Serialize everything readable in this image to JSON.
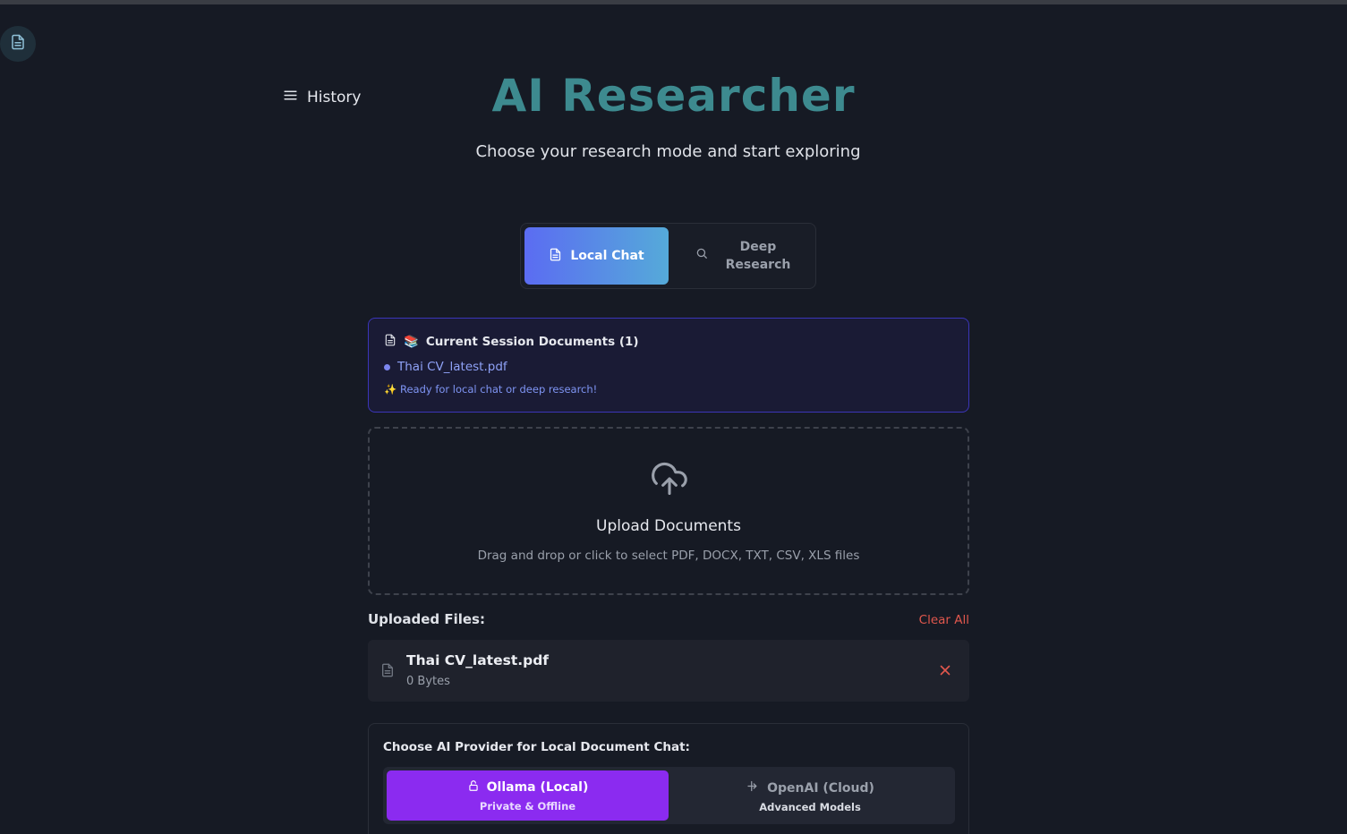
{
  "header": {
    "history_label": "History",
    "title": "AI Researcher",
    "subtitle": "Choose your research mode and start exploring"
  },
  "modes": {
    "active_label": "Local Chat",
    "inactive_label_line1": "Deep",
    "inactive_label_line2": "Research"
  },
  "session": {
    "heading_emoji": "📚",
    "heading": "Current Session Documents (1)",
    "file": "Thai CV_latest.pdf",
    "note": "✨ Ready for local chat or deep research!"
  },
  "upload": {
    "title": "Upload Documents",
    "subtitle": "Drag and drop or click to select PDF, DOCX, TXT, CSV, XLS files"
  },
  "uploaded": {
    "label": "Uploaded Files:",
    "clear_label": "Clear All",
    "files": [
      {
        "name": "Thai CV_latest.pdf",
        "size": "0 Bytes"
      }
    ]
  },
  "provider": {
    "label": "Choose AI Provider for Local Document Chat:",
    "options": [
      {
        "name": "Ollama (Local)",
        "sub": "Private & Offline",
        "icon": "lock-icon"
      },
      {
        "name": "OpenAI (Cloud)",
        "sub": "Advanced Models",
        "icon": "cloud-arrow-icon"
      }
    ]
  },
  "colors": {
    "title": "#3d8a8f",
    "mode_gradient_start": "#5b6cf2",
    "mode_gradient_end": "#55aad9",
    "provider_active": "#8b2bf0",
    "danger": "#e0574d"
  }
}
